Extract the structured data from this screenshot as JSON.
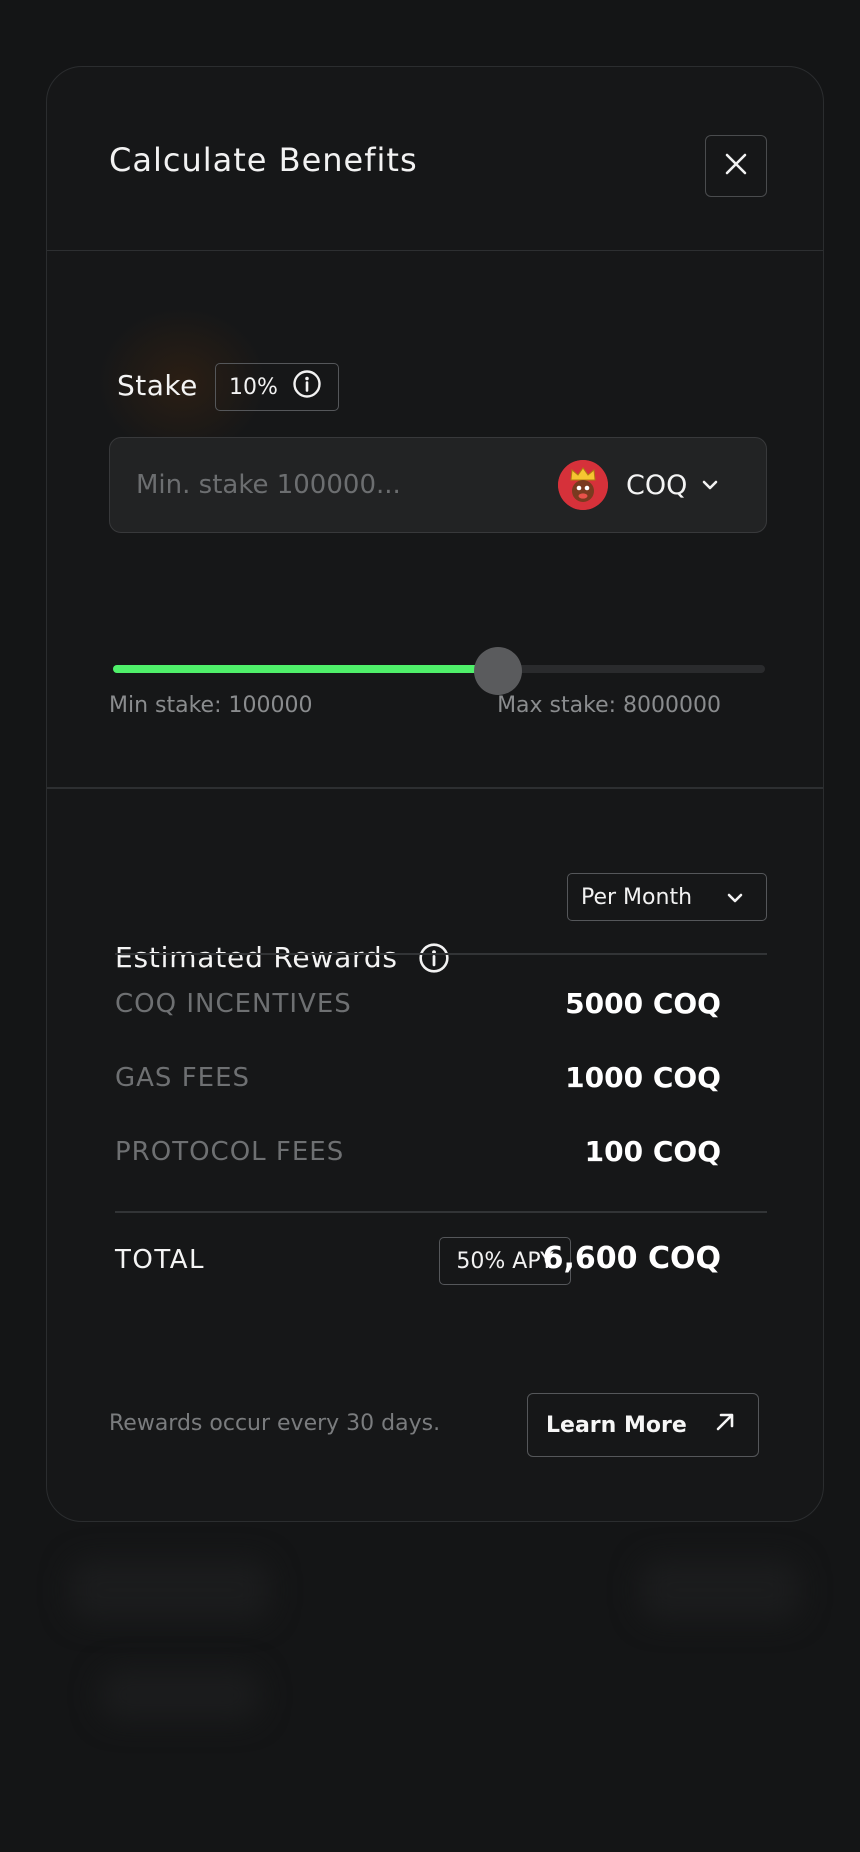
{
  "modal": {
    "title": "Calculate Benefits",
    "close_icon": "close-icon"
  },
  "stake": {
    "label": "Stake",
    "percent_badge": "10%",
    "info_icon": "info-icon",
    "input_placeholder": "Min. stake 100000...",
    "token": {
      "name": "COQ",
      "logo_icon": "coq-token-logo",
      "chevron_icon": "chevron-down-icon",
      "color": "#d6313a"
    },
    "slider": {
      "min_label": "Min stake: 100000",
      "max_label": "Max stake: 8000000",
      "fill_fraction": 0.59,
      "fill_color": "#4ff06a"
    }
  },
  "rewards": {
    "title": "Estimated Rewards",
    "info_icon": "info-icon",
    "period": {
      "selected": "Per Month",
      "chevron_icon": "chevron-down-icon"
    },
    "rows": [
      {
        "label": "COQ INCENTIVES",
        "value": "5000 COQ"
      },
      {
        "label": "GAS FEES",
        "value": "1000 COQ"
      },
      {
        "label": "PROTOCOL FEES",
        "value": "100 COQ"
      }
    ],
    "total": {
      "label": "TOTAL",
      "apy_badge": "50% APY",
      "value": "6,600 COQ"
    }
  },
  "footer": {
    "note": "Rewards occur every 30 days.",
    "learn_more_label": "Learn More",
    "learn_more_icon": "arrow-up-right-icon"
  }
}
